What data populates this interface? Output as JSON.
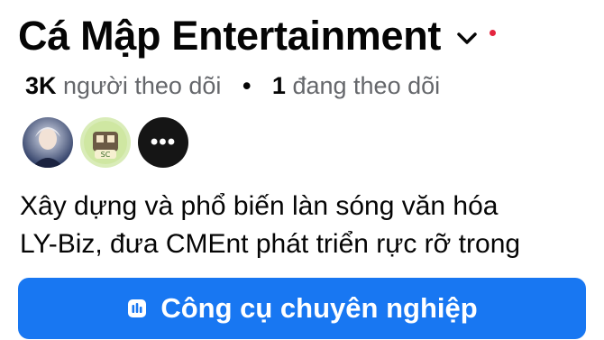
{
  "profile": {
    "name": "Cá Mập Entertainment",
    "chevron_icon": "chevron-down-icon",
    "notification_color": "#e4253e"
  },
  "stats": {
    "followers_count": "3K",
    "followers_label": "người theo dõi",
    "separator": "•",
    "following_count": "1",
    "following_label": "đang theo dõi"
  },
  "friends_preview": {
    "more_label": "•••"
  },
  "bio": {
    "line1": "Xây dựng và phổ biến làn sóng văn hóa",
    "line2": "LY-Biz, đưa CMEnt phát triển rực rỡ trong"
  },
  "cta": {
    "label": "Công cụ chuyên nghiệp",
    "icon": "dashboard-icon",
    "color": "#1877f2"
  }
}
